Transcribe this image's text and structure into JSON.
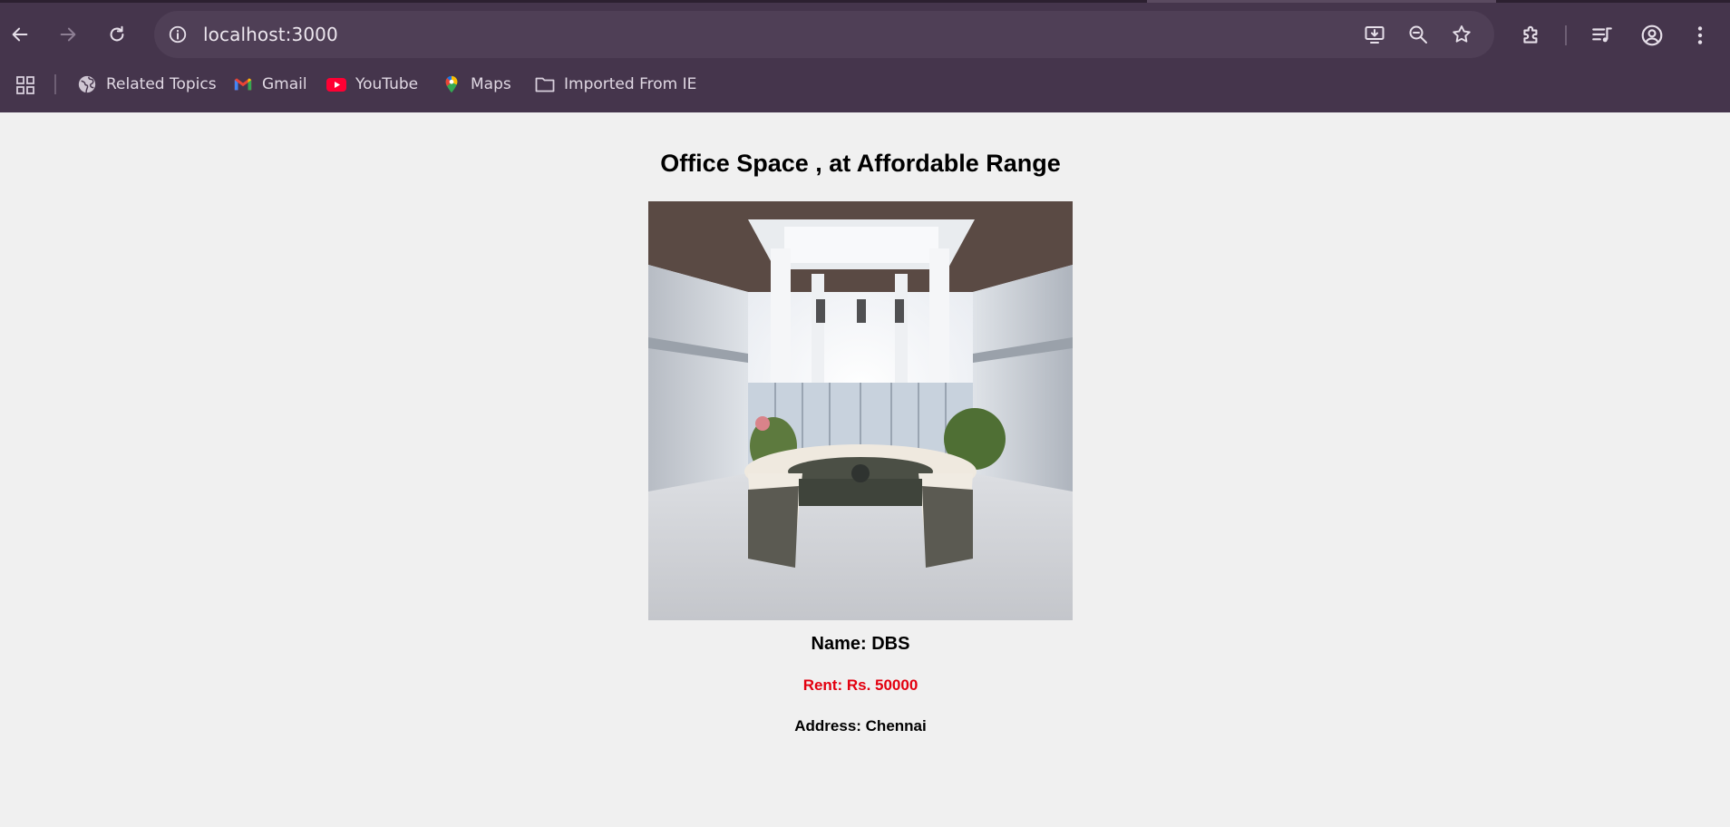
{
  "browser": {
    "url": "localhost:3000",
    "bookmarks": [
      {
        "label": "Related Topics",
        "icon": "globe-icon"
      },
      {
        "label": "Gmail",
        "icon": "gmail-icon"
      },
      {
        "label": "YouTube",
        "icon": "youtube-icon"
      },
      {
        "label": "Maps",
        "icon": "maps-icon"
      },
      {
        "label": "Imported From IE",
        "icon": "folder-icon"
      }
    ],
    "colors": {
      "chrome": "#45354c",
      "omnibox": "#4f3f56",
      "text": "#e0d8e3"
    }
  },
  "page": {
    "title": "Office Space , at Affordable Range",
    "image_alt": "office-lobby-reception-photo",
    "name": "Name: DBS",
    "rent": "Rent: Rs. 50000",
    "address": "Address: Chennai",
    "colors": {
      "background": "#f0f0f0",
      "rent": "#e3000f"
    }
  }
}
